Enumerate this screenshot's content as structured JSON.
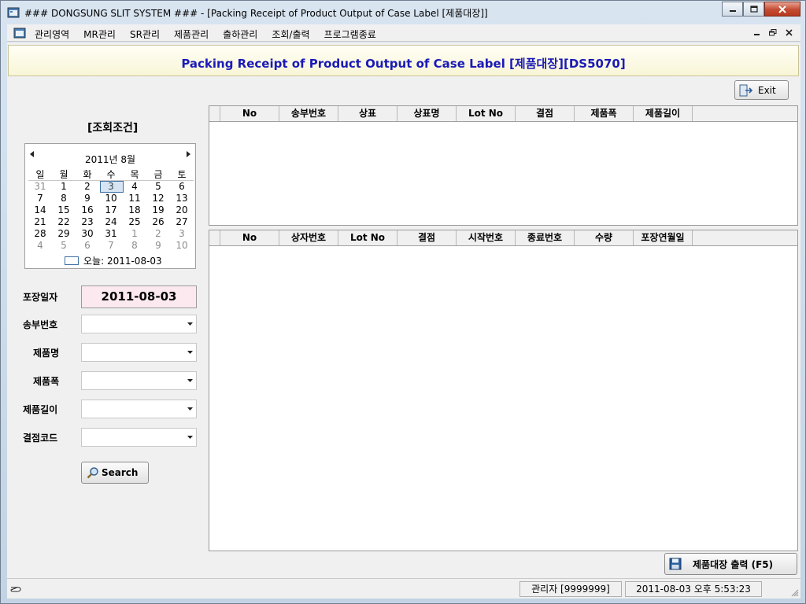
{
  "window": {
    "title": "### DONGSUNG SLIT SYSTEM ### - [Packing Receipt of Product Output of Case Label [제품대장]]"
  },
  "menu": {
    "items": [
      "관리영역",
      "MR관리",
      "SR관리",
      "제품관리",
      "출하관리",
      "조회/출력",
      "프로그램종료"
    ]
  },
  "header": {
    "title": "Packing Receipt of Product Output of Case Label [제품대장][DS5070]"
  },
  "toolbar": {
    "exit_label": "Exit"
  },
  "conditions": {
    "title": "[조회조건]"
  },
  "calendar": {
    "month_label": "2011년 8월",
    "weekdays": [
      "일",
      "월",
      "화",
      "수",
      "목",
      "금",
      "토"
    ],
    "weeks": [
      [
        "31",
        "1",
        "2",
        "3",
        "4",
        "5",
        "6"
      ],
      [
        "7",
        "8",
        "9",
        "10",
        "11",
        "12",
        "13"
      ],
      [
        "14",
        "15",
        "16",
        "17",
        "18",
        "19",
        "20"
      ],
      [
        "21",
        "22",
        "23",
        "24",
        "25",
        "26",
        "27"
      ],
      [
        "28",
        "29",
        "30",
        "31",
        "1",
        "2",
        "3"
      ],
      [
        "4",
        "5",
        "6",
        "7",
        "8",
        "9",
        "10"
      ]
    ],
    "today_label": "오늘: 2011-08-03"
  },
  "form": {
    "packing_date_label": "포장일자",
    "packing_date_value": "2011-08-03",
    "shipment_no_label": "송부번호",
    "product_name_label": "제품명",
    "product_width_label": "제품폭",
    "product_length_label": "제품길이",
    "defect_code_label": "결점코드",
    "search_label": "Search"
  },
  "grid_top": {
    "columns": [
      "No",
      "송부번호",
      "상표",
      "상표명",
      "Lot No",
      "결점",
      "제품폭",
      "제품길이"
    ]
  },
  "grid_bottom": {
    "columns": [
      "No",
      "상자번호",
      "Lot No",
      "결점",
      "시작번호",
      "종료번호",
      "수량",
      "포장연월일"
    ]
  },
  "actions": {
    "print_label": "제품대장 출력 (F5)"
  },
  "status": {
    "user": "관리자 [9999999]",
    "datetime": "2011-08-03 오후 5:53:23"
  }
}
